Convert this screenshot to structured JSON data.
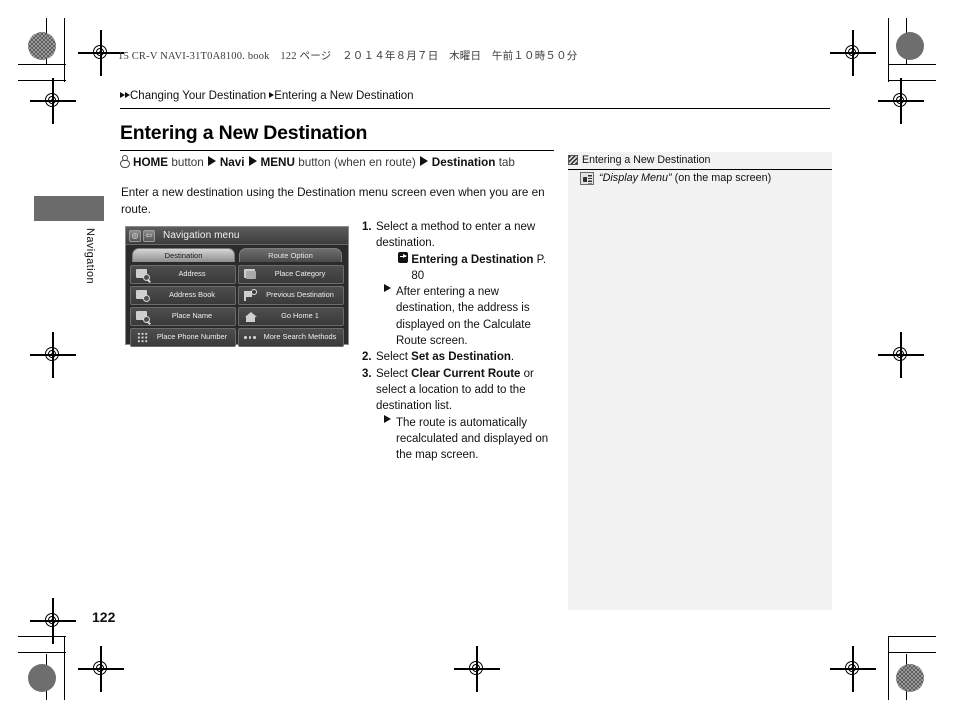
{
  "print": {
    "book_line": "15 CR-V NAVI-31T0A8100. book　122 ページ　２０１４年８月７日　木曜日　午前１０時５０分"
  },
  "breadcrumb": {
    "parent": "Changing Your Destination",
    "current": "Entering a New Destination"
  },
  "page": {
    "title": "Entering a New Destination",
    "number": "122",
    "side_tab_label": "Navigation",
    "intro": "Enter a new destination using the Destination menu screen even when you are en route."
  },
  "path": {
    "home_label": "HOME",
    "home_suffix": "button",
    "navi": "Navi",
    "menu": "MENU",
    "menu_suffix": "button (when en route)",
    "destination": "Destination",
    "destination_suffix": "tab"
  },
  "screenshot": {
    "title": "Navigation menu",
    "tabs": [
      {
        "label": "Destination",
        "selected": true
      },
      {
        "label": "Route Option",
        "selected": false
      }
    ],
    "menu_items": [
      {
        "label": "Address",
        "icon": "address-search-icon"
      },
      {
        "label": "Place Category",
        "icon": "place-category-icon"
      },
      {
        "label": "Address Book",
        "icon": "address-book-icon"
      },
      {
        "label": "Previous Destination",
        "icon": "previous-destination-flag-icon"
      },
      {
        "label": "Place Name",
        "icon": "place-name-search-icon"
      },
      {
        "label": "Go Home 1",
        "icon": "home-icon"
      },
      {
        "label": "Place Phone Number",
        "icon": "keypad-icon"
      },
      {
        "label": "More Search Methods",
        "icon": "ellipsis-icon"
      }
    ]
  },
  "steps": [
    {
      "num": "1.",
      "text": "Select a method to enter a new destination.",
      "reference": {
        "label": "Entering a Destination",
        "page": "P. 80"
      },
      "bullet": "After entering a new destination, the address is displayed on the Calculate Route screen."
    },
    {
      "num": "2.",
      "text_pre": "Select ",
      "text_bold": "Set as Destination",
      "text_post": "."
    },
    {
      "num": "3.",
      "text_pre": "Select ",
      "text_bold": "Clear Current Route",
      "text_post": " or select a location to add to the destination list.",
      "bullet": "The route is automatically recalculated and displayed on the map screen."
    }
  ],
  "sidenote": {
    "header": "Entering a New Destination",
    "voice_command": "“Display Menu”",
    "voice_suffix": " (on the map screen)"
  },
  "colors": {
    "note_bg": "#f2f2f2",
    "tab_block": "#6b6b6b",
    "screen_bg": "#2b2b2b"
  }
}
